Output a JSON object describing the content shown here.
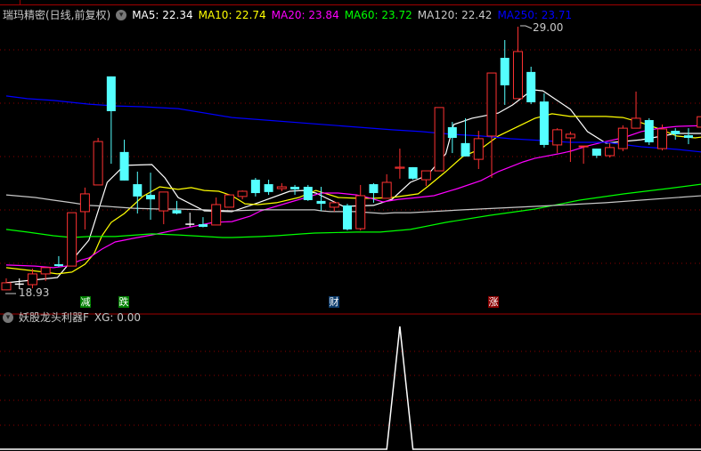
{
  "header": {
    "title": "瑞玛精密(日线,前复权)",
    "ma": [
      {
        "label": "MA5: 22.34",
        "color": "#ffffff"
      },
      {
        "label": "MA10: 22.74",
        "color": "#ffff00"
      },
      {
        "label": "MA20: 23.84",
        "color": "#ff00ff"
      },
      {
        "label": "MA60: 23.72",
        "color": "#00ff00"
      },
      {
        "label": "MA120: 22.42",
        "color": "#c8c8c8"
      },
      {
        "label": "MA250: 23.71",
        "color": "#0000ff"
      }
    ]
  },
  "price_labels": {
    "high": "29.00",
    "low": "18.93"
  },
  "signals": [
    {
      "text": "减",
      "candle": 6,
      "color": "#008000"
    },
    {
      "text": "跌",
      "candle": 8,
      "color": "#008000"
    },
    {
      "text": "财",
      "candle": 25,
      "color": "#0a3a6a"
    },
    {
      "text": "涨",
      "candle": 37,
      "color": "#8b0000"
    }
  ],
  "indicator": {
    "title": "妖股龙头利器F",
    "value_label": "XG: 0.00"
  },
  "colors": {
    "up": "#ff3232",
    "down": "#54ffff",
    "grid": "#8b0000",
    "doji": "#ffffff"
  },
  "chart_data": {
    "type": "candlestick",
    "ylim": [
      18.93,
      29.0
    ],
    "candles_ohlc": [
      [
        18.94,
        19.38,
        18.93,
        19.21
      ],
      [
        19.16,
        19.38,
        18.97,
        19.16
      ],
      [
        19.14,
        19.75,
        19.0,
        19.55
      ],
      [
        19.55,
        19.8,
        19.28,
        19.79
      ],
      [
        19.92,
        20.23,
        19.82,
        19.85
      ],
      [
        19.85,
        21.89,
        19.85,
        21.89
      ],
      [
        21.93,
        22.85,
        21.25,
        22.61
      ],
      [
        22.95,
        24.75,
        22.95,
        24.61
      ],
      [
        27.1,
        27.1,
        23.76,
        25.77
      ],
      [
        24.21,
        24.68,
        23.12,
        23.12
      ],
      [
        22.98,
        23.46,
        21.86,
        22.51
      ],
      [
        22.57,
        23.42,
        21.62,
        22.4
      ],
      [
        21.96,
        22.68,
        21.45,
        22.68
      ],
      [
        21.99,
        22.34,
        21.83,
        21.86
      ],
      [
        21.45,
        21.89,
        21.35,
        21.45
      ],
      [
        21.45,
        21.72,
        21.33,
        21.35
      ],
      [
        21.42,
        22.47,
        21.42,
        22.2
      ],
      [
        22.1,
        22.6,
        22.1,
        22.57
      ],
      [
        22.51,
        22.74,
        22.4,
        22.71
      ],
      [
        23.15,
        23.22,
        22.51,
        22.64
      ],
      [
        22.98,
        23.15,
        22.57,
        22.68
      ],
      [
        22.81,
        23.02,
        22.71,
        22.88
      ],
      [
        22.88,
        22.95,
        22.57,
        22.78
      ],
      [
        22.88,
        22.95,
        22.34,
        22.37
      ],
      [
        22.34,
        22.88,
        21.96,
        22.23
      ],
      [
        22.1,
        22.34,
        21.93,
        22.27
      ],
      [
        22.17,
        22.23,
        21.21,
        21.25
      ],
      [
        21.28,
        22.95,
        21.21,
        22.54
      ],
      [
        22.98,
        23.02,
        22.27,
        22.64
      ],
      [
        22.44,
        23.36,
        22.44,
        23.05
      ],
      [
        23.59,
        24.34,
        23.19,
        23.63
      ],
      [
        23.63,
        23.63,
        23.15,
        23.19
      ],
      [
        23.15,
        23.49,
        22.91,
        23.49
      ],
      [
        23.49,
        25.91,
        23.49,
        25.91
      ],
      [
        25.16,
        25.36,
        24.17,
        24.75
      ],
      [
        24.55,
        25.5,
        24.04,
        24.04
      ],
      [
        23.93,
        25.02,
        23.56,
        24.72
      ],
      [
        24.82,
        27.23,
        23.22,
        27.23
      ],
      [
        27.81,
        28.49,
        26.01,
        26.76
      ],
      [
        26.25,
        29.0,
        26.25,
        28.05
      ],
      [
        27.27,
        27.47,
        26.04,
        26.11
      ],
      [
        26.14,
        26.45,
        24.38,
        24.48
      ],
      [
        24.48,
        25.12,
        24.17,
        25.06
      ],
      [
        24.75,
        24.99,
        23.83,
        24.89
      ],
      [
        24.41,
        24.44,
        23.76,
        24.44
      ],
      [
        24.34,
        24.34,
        23.98,
        24.07
      ],
      [
        24.07,
        24.55,
        24.0,
        24.38
      ],
      [
        24.34,
        25.23,
        24.24,
        25.12
      ],
      [
        25.12,
        26.52,
        25.12,
        25.5
      ],
      [
        25.43,
        25.5,
        24.48,
        24.58
      ],
      [
        24.34,
        25.26,
        24.27,
        25.09
      ],
      [
        25.02,
        25.12,
        24.68,
        24.89
      ],
      [
        24.85,
        25.12,
        24.51,
        24.75
      ],
      [
        25.16,
        25.56,
        25.16,
        25.56
      ]
    ],
    "ma_series": [
      {
        "name": "MA5",
        "color": "#ffffff",
        "points": [
          [
            0,
            19.21
          ],
          [
            3.9,
            19.41
          ],
          [
            6.3,
            20.84
          ],
          [
            7.7,
            23.05
          ],
          [
            9,
            23.7
          ],
          [
            11.1,
            23.73
          ],
          [
            12.1,
            23.22
          ],
          [
            13.1,
            22.47
          ],
          [
            15.1,
            21.96
          ],
          [
            17.2,
            21.93
          ],
          [
            19.2,
            22.27
          ],
          [
            21.6,
            22.71
          ],
          [
            22.6,
            22.74
          ],
          [
            23.6,
            22.64
          ],
          [
            25.7,
            22.13
          ],
          [
            28,
            22.17
          ],
          [
            29.4,
            22.4
          ],
          [
            30.8,
            23.05
          ],
          [
            32.1,
            23.32
          ],
          [
            33.5,
            24.14
          ],
          [
            34.1,
            25.26
          ],
          [
            35.5,
            25.5
          ],
          [
            37.5,
            25.7
          ],
          [
            38.6,
            26.01
          ],
          [
            40.1,
            26.59
          ],
          [
            40.9,
            26.55
          ],
          [
            43,
            25.84
          ],
          [
            44.3,
            24.99
          ],
          [
            45.7,
            24.55
          ],
          [
            48.4,
            24.68
          ],
          [
            51.1,
            24.92
          ],
          [
            53,
            24.92
          ]
        ]
      },
      {
        "name": "MA10",
        "color": "#ffff00",
        "points": [
          [
            0,
            19.79
          ],
          [
            2.9,
            19.62
          ],
          [
            3.9,
            19.55
          ],
          [
            5,
            19.62
          ],
          [
            6,
            19.92
          ],
          [
            6.7,
            20.33
          ],
          [
            7.3,
            21.01
          ],
          [
            8,
            21.52
          ],
          [
            9,
            21.86
          ],
          [
            10.4,
            22.51
          ],
          [
            11.7,
            22.88
          ],
          [
            13.1,
            22.78
          ],
          [
            14.1,
            22.85
          ],
          [
            15.1,
            22.74
          ],
          [
            16.2,
            22.71
          ],
          [
            17.2,
            22.54
          ],
          [
            18.2,
            22.23
          ],
          [
            19.2,
            22.2
          ],
          [
            20.6,
            22.27
          ],
          [
            22.3,
            22.47
          ],
          [
            23.6,
            22.74
          ],
          [
            25.3,
            22.47
          ],
          [
            26.7,
            22.44
          ],
          [
            28,
            22.44
          ],
          [
            29.4,
            22.47
          ],
          [
            30.4,
            22.54
          ],
          [
            31.4,
            22.61
          ],
          [
            32.1,
            22.88
          ],
          [
            33.5,
            23.46
          ],
          [
            34.8,
            24.04
          ],
          [
            36.2,
            24.34
          ],
          [
            37.5,
            24.82
          ],
          [
            38.9,
            25.16
          ],
          [
            40.3,
            25.5
          ],
          [
            41.6,
            25.67
          ],
          [
            43,
            25.57
          ],
          [
            44.3,
            25.57
          ],
          [
            45.7,
            25.57
          ],
          [
            47,
            25.53
          ],
          [
            48.4,
            25.33
          ],
          [
            49.8,
            25.09
          ],
          [
            51.1,
            24.82
          ],
          [
            52.5,
            24.75
          ],
          [
            53,
            24.78
          ]
        ]
      },
      {
        "name": "MA20",
        "color": "#ff00ff",
        "points": [
          [
            0,
            19.89
          ],
          [
            2.2,
            19.85
          ],
          [
            3.6,
            19.79
          ],
          [
            4.6,
            19.85
          ],
          [
            5.6,
            20.06
          ],
          [
            6.3,
            20.16
          ],
          [
            7.3,
            20.5
          ],
          [
            8.3,
            20.77
          ],
          [
            9.7,
            20.91
          ],
          [
            11.1,
            21.04
          ],
          [
            13.1,
            21.25
          ],
          [
            14.1,
            21.35
          ],
          [
            15.8,
            21.52
          ],
          [
            17.2,
            21.55
          ],
          [
            18.6,
            21.76
          ],
          [
            19.4,
            21.96
          ],
          [
            21.7,
            22.3
          ],
          [
            23.1,
            22.51
          ],
          [
            24,
            22.64
          ],
          [
            25.3,
            22.64
          ],
          [
            26.7,
            22.57
          ],
          [
            27.8,
            22.44
          ],
          [
            28.7,
            22.3
          ],
          [
            29.9,
            22.4
          ],
          [
            30.8,
            22.44
          ],
          [
            32.6,
            22.54
          ],
          [
            34.4,
            22.81
          ],
          [
            36.2,
            23.12
          ],
          [
            37.5,
            23.46
          ],
          [
            39.4,
            23.83
          ],
          [
            40.3,
            23.97
          ],
          [
            42.1,
            24.14
          ],
          [
            43,
            24.24
          ],
          [
            44.3,
            24.44
          ],
          [
            45.7,
            24.61
          ],
          [
            47,
            24.75
          ],
          [
            48.4,
            24.99
          ],
          [
            49.8,
            25.12
          ],
          [
            51.1,
            25.19
          ],
          [
            53,
            25.22
          ]
        ]
      },
      {
        "name": "MA60",
        "color": "#00ff00",
        "points": [
          [
            0,
            21.25
          ],
          [
            1.6,
            21.15
          ],
          [
            3.6,
            21.01
          ],
          [
            5,
            20.94
          ],
          [
            6.3,
            20.98
          ],
          [
            8.3,
            20.98
          ],
          [
            11.1,
            21.08
          ],
          [
            13.1,
            21.04
          ],
          [
            16.5,
            20.94
          ],
          [
            17.2,
            20.94
          ],
          [
            19.4,
            20.98
          ],
          [
            20.6,
            21.01
          ],
          [
            22.6,
            21.08
          ],
          [
            23.5,
            21.11
          ],
          [
            26.7,
            21.15
          ],
          [
            28.5,
            21.15
          ],
          [
            30.8,
            21.25
          ],
          [
            33.5,
            21.52
          ],
          [
            36.9,
            21.79
          ],
          [
            40.3,
            22.03
          ],
          [
            43.7,
            22.37
          ],
          [
            47.1,
            22.61
          ],
          [
            50.4,
            22.81
          ],
          [
            53,
            22.98
          ]
        ]
      },
      {
        "name": "MA120",
        "color": "#c8c8c8",
        "points": [
          [
            0,
            22.57
          ],
          [
            2.2,
            22.47
          ],
          [
            3.6,
            22.37
          ],
          [
            5,
            22.27
          ],
          [
            6.3,
            22.17
          ],
          [
            7.7,
            22.13
          ],
          [
            9.7,
            22.06
          ],
          [
            11.7,
            22.03
          ],
          [
            13.1,
            22.03
          ],
          [
            15.1,
            22.0
          ],
          [
            17.2,
            21.96
          ],
          [
            19.4,
            22.0
          ],
          [
            23.5,
            22.0
          ],
          [
            24,
            21.96
          ],
          [
            24.7,
            21.93
          ],
          [
            26.6,
            21.93
          ],
          [
            28.7,
            21.86
          ],
          [
            29.6,
            21.89
          ],
          [
            30.8,
            21.89
          ],
          [
            34.8,
            22.0
          ],
          [
            40.3,
            22.13
          ],
          [
            45.7,
            22.27
          ],
          [
            53,
            22.54
          ]
        ]
      },
      {
        "name": "MA250",
        "color": "#0000ff",
        "points": [
          [
            0,
            26.35
          ],
          [
            1.6,
            26.25
          ],
          [
            3.6,
            26.18
          ],
          [
            6.3,
            26.04
          ],
          [
            8.3,
            25.97
          ],
          [
            10.4,
            25.94
          ],
          [
            13.1,
            25.87
          ],
          [
            17.2,
            25.53
          ],
          [
            29.4,
            25.06
          ],
          [
            31.6,
            24.99
          ],
          [
            33.9,
            24.89
          ],
          [
            36.2,
            24.82
          ],
          [
            38.4,
            24.72
          ],
          [
            40.7,
            24.65
          ],
          [
            43,
            24.58
          ],
          [
            45.7,
            24.58
          ],
          [
            48.4,
            24.41
          ],
          [
            51.1,
            24.31
          ],
          [
            53,
            24.21
          ]
        ]
      }
    ],
    "xg_values_nonzero": [
      [
        30,
        1
      ]
    ],
    "xg_ylim": [
      0,
      1
    ]
  }
}
